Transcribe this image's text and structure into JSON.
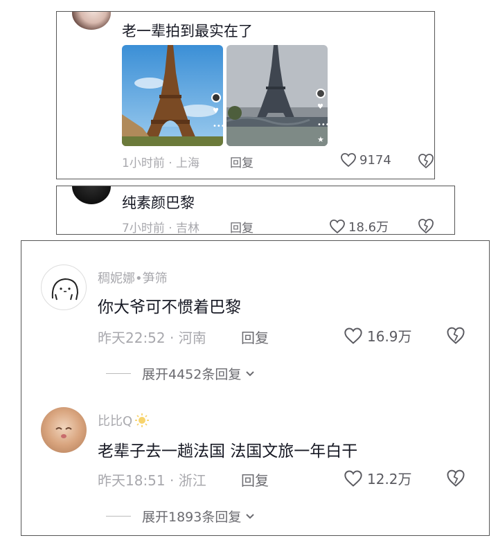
{
  "comments": [
    {
      "text": "老一辈拍到最实在了",
      "time": "1小时前",
      "location": "上海",
      "reply_label": "回复",
      "likes": "9174"
    },
    {
      "text": "纯素颜巴黎",
      "time": "7小时前",
      "location": "吉林",
      "reply_label": "回复",
      "likes": "18.6万"
    },
    {
      "username": "稠妮娜•笋筛",
      "text": "你大爷可不惯着巴黎",
      "time": "昨天22:52",
      "location": "河南",
      "reply_label": "回复",
      "likes": "16.9万",
      "expand_label": "展开4452条回复"
    },
    {
      "username": "比比Q",
      "text": "老辈子去一趟法国 法国文旅一年白干",
      "time": "昨天18:51",
      "location": "浙江",
      "reply_label": "回复",
      "likes": "12.2万",
      "expand_label": "展开1893条回复"
    }
  ],
  "meta_separator": "·",
  "icons": [
    "heart-icon",
    "dislike-icon",
    "chevron-down-icon",
    "sun-badge-icon"
  ],
  "colors": {
    "meta": "#a8a8ad",
    "text": "#161823",
    "border": "#555555"
  }
}
